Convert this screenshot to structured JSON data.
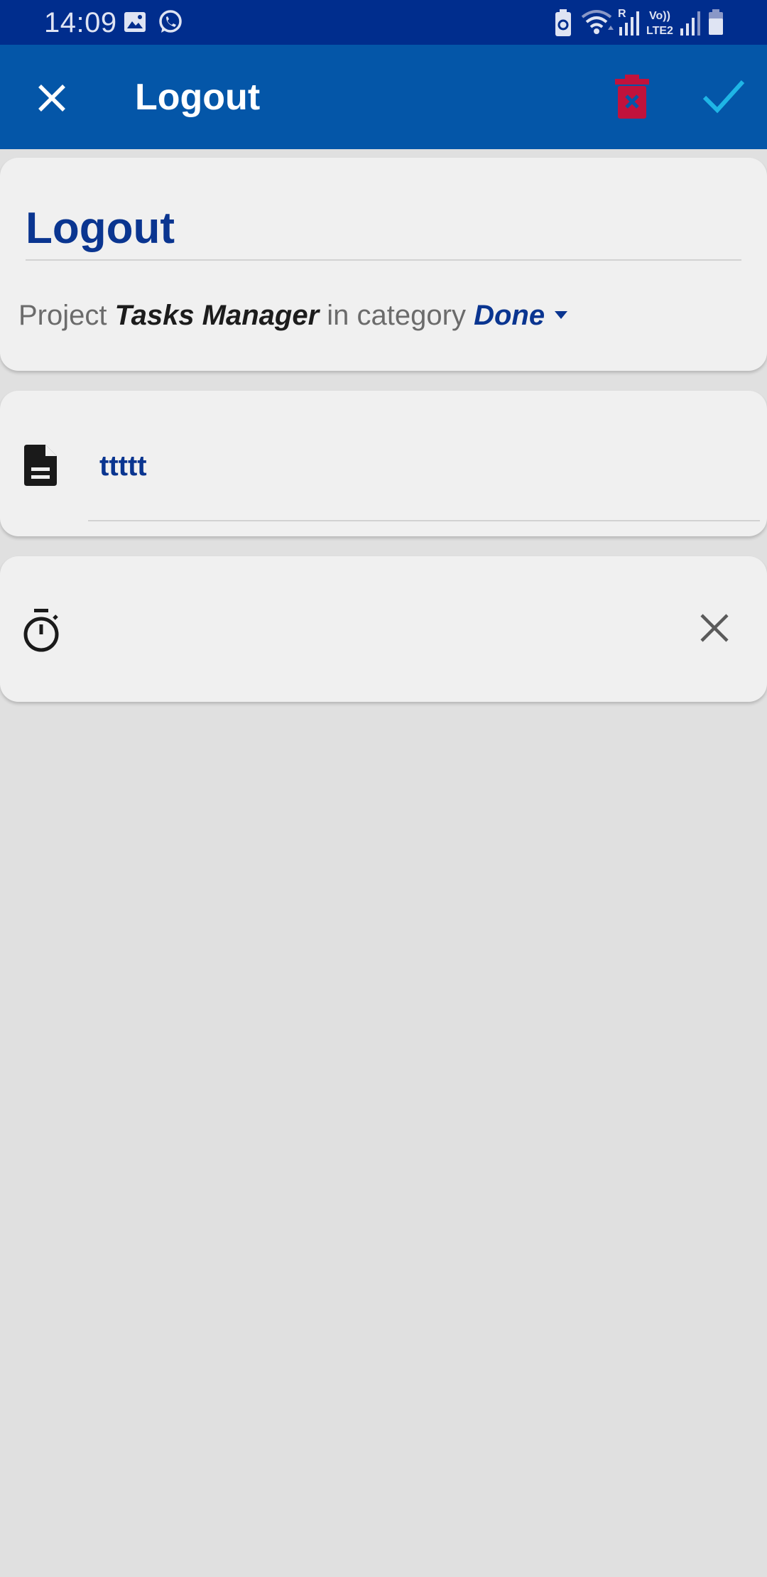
{
  "status_bar": {
    "time": "14:09",
    "signal_text_r": "R",
    "signal_text_volte": "Vo))",
    "signal_text_lte": "LTE2",
    "icons": [
      "gallery-icon",
      "whatsapp-icon",
      "battery-saver-icon",
      "wifi-icon",
      "signal-icon",
      "signal-icon",
      "battery-icon"
    ]
  },
  "app_bar": {
    "title": "Logout",
    "close_icon": "close-icon",
    "delete_icon": "delete-icon",
    "save_icon": "check-icon"
  },
  "task": {
    "title": "Logout",
    "project_prefix": "Project",
    "project_name": "Tasks Manager",
    "category_prefix": "in category",
    "category_name": "Done",
    "description": "ttttt",
    "description_icon": "document-icon",
    "timer_icon": "stopwatch-icon",
    "timer_clear_icon": "close-icon"
  },
  "colors": {
    "status_bar": "#002d8d",
    "app_bar": "#0456a8",
    "accent_text": "#0a3590",
    "delete": "#c1123c",
    "check": "#1fb5e6",
    "background": "#e0e0e0",
    "card": "#f0f0f0"
  }
}
